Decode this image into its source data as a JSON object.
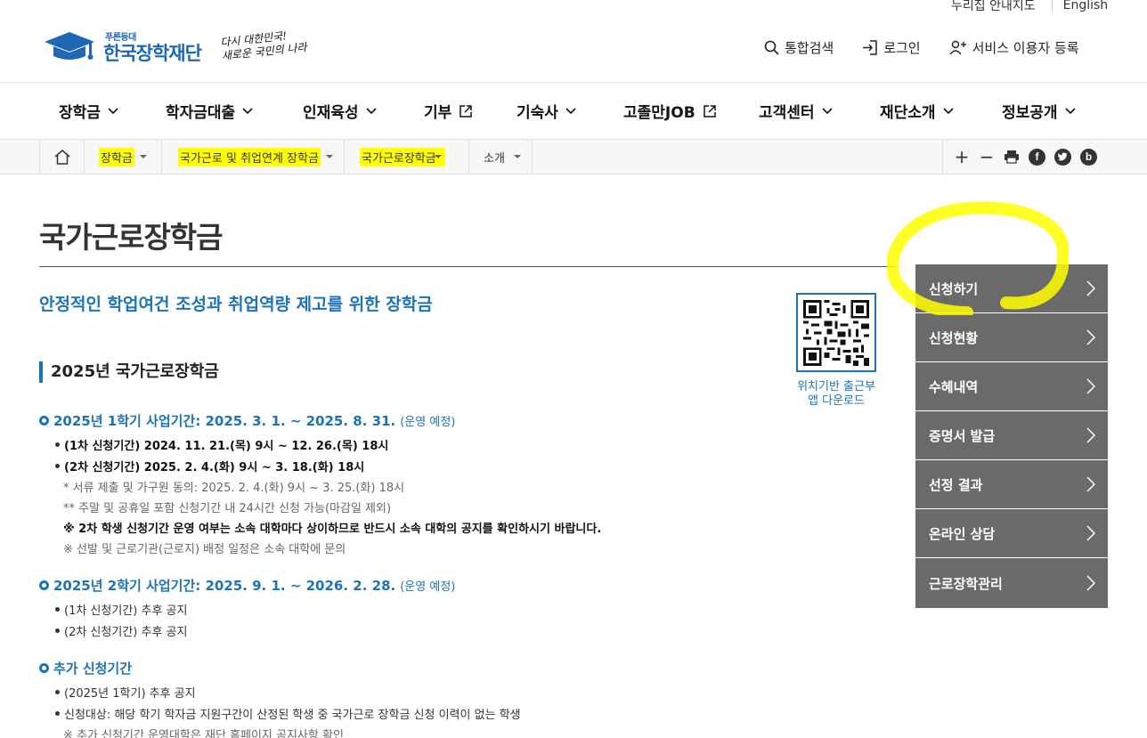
{
  "util": {
    "map": "누리집 안내지도",
    "english": "English"
  },
  "logo": {
    "small": "푸른등대",
    "big": "한국장학재단",
    "slogan1": "다시 대한민국!",
    "slogan2": "새로운 국민의 나라"
  },
  "header_links": {
    "search": "통합검색",
    "login": "로그인",
    "register": "서비스 이용자 등록"
  },
  "gnb": [
    "장학금",
    "학자금대출",
    "인재육성",
    "기부",
    "기숙사",
    "고졸만JOB",
    "고객센터",
    "재단소개",
    "정보공개"
  ],
  "breadcrumb": [
    "장학금",
    "국가근로 및 취업연계 장학금",
    "국가근로장학금",
    "소개"
  ],
  "tools": {
    "plus": "+",
    "minus": "−",
    "facebook": "f",
    "blog": "b"
  },
  "page": {
    "title": "국가근로장학금",
    "subtitle": "안정적인 학업여건 조성과 취업역량 제고를 위한 장학금",
    "qr_caption1": "위치기반 출근부",
    "qr_caption2": "앱 다운로드",
    "h2": "2025년 국가근로장학금"
  },
  "sections": {
    "s1": {
      "title": "2025년 1학기 사업기간: 2025. 3. 1. ~ 2025. 8. 31.",
      "note": "(운영 예정)"
    },
    "s1_items": [
      "(1차 신청기간) 2024. 11. 21.(목) 9시 ~ 12. 26.(목) 18시",
      "(2차 신청기간) 2025. 2. 4.(화) 9시 ~ 3. 18.(화) 18시"
    ],
    "s1_subs": [
      "* 서류 제출 및 가구원 동의: 2025. 2. 4.(화) 9시 ~ 3. 25.(화) 18시",
      "** 주말 및 공휴일 포함 신청기간 내 24시간 신청 가능(마감일 제외)",
      "※ 2차 학생 신청기간 운영 여부는 소속 대학마다 상이하므로 반드시 소속 대학의 공지를 확인하시기 바랍니다.",
      "※ 선발 및 근로기관(근로지) 배정 일정은 소속 대학에 문의"
    ],
    "s2": {
      "title": "2025년 2학기 사업기간: 2025. 9. 1. ~ 2026. 2. 28.",
      "note": "(운영 예정)"
    },
    "s2_items": [
      "(1차 신청기간) 추후 공지",
      "(2차 신청기간) 추후 공지"
    ],
    "s3": {
      "title": "추가 신청기간"
    },
    "s3_items": [
      "(2025년 1학기) 추후 공지",
      "신청대상: 해당 학기 학자금 지원구간이 산정된 학생 중 국가근로 장학금 신청 이력이 없는 학생"
    ],
    "s3_subs": [
      "※ 추가 신청기간 운영대학은 재단 홈페이지 공지사항 확인"
    ]
  },
  "side_menu": [
    "신청하기",
    "신청현황",
    "수혜내역",
    "증명서 발급",
    "선정 결과",
    "온라인 상담",
    "근로장학관리"
  ],
  "colors": {
    "brand": "#1d73b8",
    "side_bg": "#6a6a6a",
    "highlight": "#ffff00"
  }
}
